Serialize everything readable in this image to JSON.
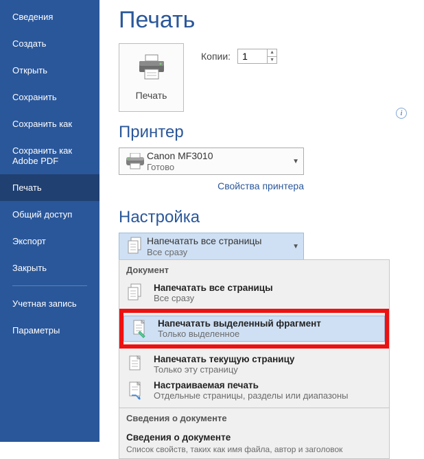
{
  "sidebar": {
    "items": [
      {
        "label": "Сведения"
      },
      {
        "label": "Создать"
      },
      {
        "label": "Открыть"
      },
      {
        "label": "Сохранить"
      },
      {
        "label": "Сохранить как"
      },
      {
        "label": "Сохранить как Adobe PDF"
      },
      {
        "label": "Печать"
      },
      {
        "label": "Общий доступ"
      },
      {
        "label": "Экспорт"
      },
      {
        "label": "Закрыть"
      }
    ],
    "footer": [
      {
        "label": "Учетная запись"
      },
      {
        "label": "Параметры"
      }
    ]
  },
  "main": {
    "title": "Печать",
    "print_button": "Печать",
    "copies_label": "Копии:",
    "copies_value": "1",
    "printer_heading": "Принтер",
    "printer": {
      "name": "Canon MF3010",
      "status": "Готово"
    },
    "printer_props_link": "Свойства принтера",
    "settings_heading": "Настройка",
    "range_selected": {
      "t1": "Напечатать все страницы",
      "t2": "Все сразу"
    },
    "menu": {
      "group1": "Документ",
      "items": [
        {
          "t1": "Напечатать все страницы",
          "t2": "Все сразу"
        },
        {
          "t1": "Напечатать выделенный фрагмент",
          "t2": "Только выделенное"
        },
        {
          "t1": "Напечатать текущую страницу",
          "t2": "Только эту страницу"
        },
        {
          "t1": "Настраиваемая печать",
          "t2": "Отдельные страницы, разделы или диапазоны"
        }
      ],
      "group2": "Сведения о документе",
      "docinfo": {
        "t1": "Сведения о документе",
        "t2": "Список свойств, таких как имя файла, автор и заголовок"
      }
    }
  }
}
